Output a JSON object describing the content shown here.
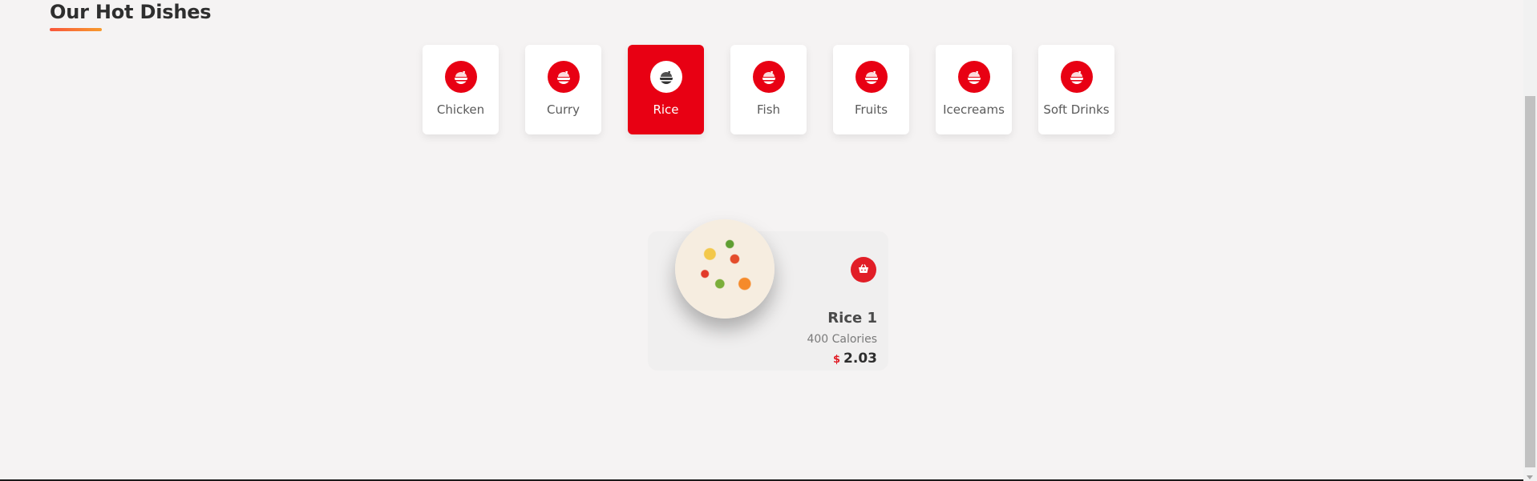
{
  "section": {
    "title": "Our Hot Dishes",
    "accent_color": "#f9563b"
  },
  "categories": [
    {
      "label": "Chicken",
      "icon": "dish-icon",
      "active": false
    },
    {
      "label": "Curry",
      "icon": "dish-icon",
      "active": false
    },
    {
      "label": "Rice",
      "icon": "dish-icon",
      "active": true
    },
    {
      "label": "Fish",
      "icon": "dish-icon",
      "active": false
    },
    {
      "label": "Fruits",
      "icon": "dish-icon",
      "active": false
    },
    {
      "label": "Icecreams",
      "icon": "dish-icon",
      "active": false
    },
    {
      "label": "Soft Drinks",
      "icon": "dish-icon",
      "active": false
    }
  ],
  "dish": {
    "name": "Rice 1",
    "calories": "400 Calories",
    "currency": "$",
    "price": "2.03",
    "cart_icon": "shopping-basket-icon",
    "image": "rice-bowl-image"
  },
  "colors": {
    "primary_red": "#e80013",
    "background": "#f5f3f3"
  }
}
